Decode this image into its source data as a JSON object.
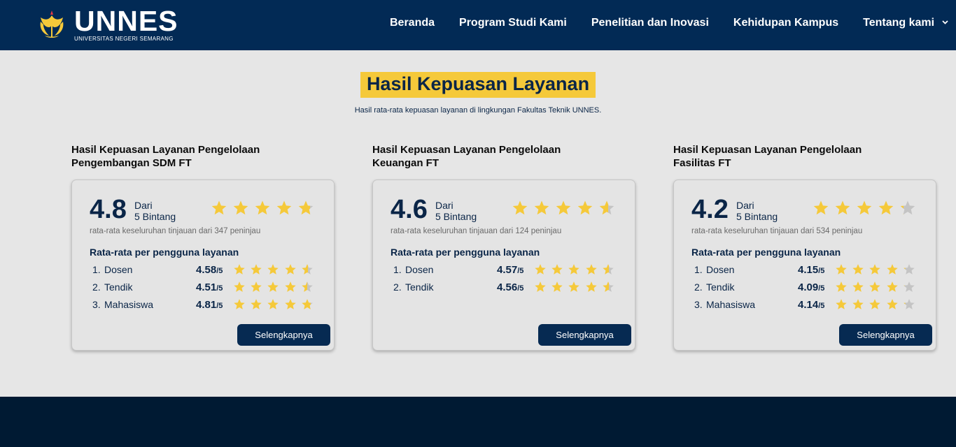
{
  "brand": {
    "name": "UNNES",
    "subtitle": "UNIVERSITAS NEGERI SEMARANG"
  },
  "nav": {
    "items": [
      {
        "label": "Beranda"
      },
      {
        "label": "Program Studi Kami"
      },
      {
        "label": "Penelitian dan Inovasi"
      },
      {
        "label": "Kehidupan Kampus"
      },
      {
        "label": "Tentang kami"
      }
    ]
  },
  "heading": {
    "title": "Hasil Kepuasan Layanan",
    "subtitle": "Hasil rata-rata kepuasan layanan di lingkungan Fakultas Teknik UNNES."
  },
  "colors": {
    "navy": "#022a55",
    "star": "#f5c93a",
    "star_empty": "#c4c4c4",
    "highlight": "#f5c93a"
  },
  "cards": [
    {
      "title": "Hasil Kepuasan Layanan Pengelolaan Pengembangan SDM FT",
      "score": "4.8",
      "score_of_line1": "Dari",
      "score_of_line2": "5 Bintang",
      "rating_value": 4.8,
      "reviews": "rata-rata keseluruhan tinjauan dari 347 peninjau",
      "per_user_title": "Rata-rata per pengguna layanan",
      "rows": [
        {
          "num": "1.",
          "name": "Dosen",
          "score": "4.58",
          "suffix": "/5",
          "value": 4.58
        },
        {
          "num": "2.",
          "name": "Tendik",
          "score": "4.51",
          "suffix": "/5",
          "value": 4.51
        },
        {
          "num": "3.",
          "name": "Mahasiswa",
          "score": "4.81",
          "suffix": "/5",
          "value": 4.81
        }
      ],
      "button": "Selengkapnya"
    },
    {
      "title": "Hasil Kepuasan Layanan Pengelolaan Keuangan FT",
      "score": "4.6",
      "score_of_line1": "Dari",
      "score_of_line2": "5 Bintang",
      "rating_value": 4.6,
      "reviews": "rata-rata keseluruhan tinjauan dari 124 peninjau",
      "per_user_title": "Rata-rata per pengguna layanan",
      "rows": [
        {
          "num": "1.",
          "name": "Dosen",
          "score": "4.57",
          "suffix": "/5",
          "value": 4.57
        },
        {
          "num": "2.",
          "name": "Tendik",
          "score": "4.56",
          "suffix": "/5",
          "value": 4.56
        }
      ],
      "button": "Selengkapnya"
    },
    {
      "title": "Hasil Kepuasan Layanan Pengelolaan Fasilitas FT",
      "score": "4.2",
      "score_of_line1": "Dari",
      "score_of_line2": "5 Bintang",
      "rating_value": 4.2,
      "reviews": "rata-rata keseluruhan tinjauan dari 534 peninjau",
      "per_user_title": "Rata-rata per pengguna layanan",
      "rows": [
        {
          "num": "1.",
          "name": "Dosen",
          "score": "4.15",
          "suffix": "/5",
          "value": 4.15
        },
        {
          "num": "2.",
          "name": "Tendik",
          "score": "4.09",
          "suffix": "/5",
          "value": 4.09
        },
        {
          "num": "3.",
          "name": "Mahasiswa",
          "score": "4.14",
          "suffix": "/5",
          "value": 4.14
        }
      ],
      "button": "Selengkapnya"
    }
  ]
}
